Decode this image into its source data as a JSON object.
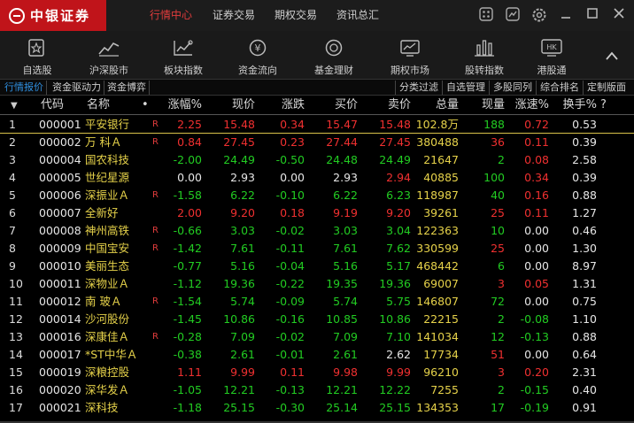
{
  "app": {
    "logo_text": "中银证券",
    "menu": [
      {
        "label": "行情中心",
        "active": true
      },
      {
        "label": "证券交易",
        "active": false
      },
      {
        "label": "期权交易",
        "active": false
      },
      {
        "label": "资讯总汇",
        "active": false
      }
    ]
  },
  "toolbar": {
    "items": [
      {
        "label": "自选股",
        "icon": "star-list-icon"
      },
      {
        "label": "沪深股市",
        "icon": "trend-chart-icon"
      },
      {
        "label": "板块指数",
        "icon": "sector-index-icon"
      },
      {
        "label": "资金流向",
        "icon": "money-flow-icon"
      },
      {
        "label": "基金理财",
        "icon": "fund-coin-icon"
      },
      {
        "label": "期权市场",
        "icon": "options-market-icon"
      },
      {
        "label": "股转指数",
        "icon": "bar-chart-icon"
      },
      {
        "label": "港股通",
        "icon": "hk-badge-icon",
        "badge": "HK"
      }
    ],
    "collapse_symbol": "^"
  },
  "tabs": {
    "left": [
      {
        "label": "行情报价",
        "active": true
      },
      {
        "label": "资金驱动力",
        "active": false
      },
      {
        "label": "资金博弈",
        "active": false
      }
    ],
    "right": [
      "分类过滤",
      "自选管理",
      "多股同列",
      "综合排名",
      "定制版面"
    ]
  },
  "table": {
    "headers": {
      "code": "代码",
      "name": "名称",
      "dot": "•",
      "change_pct": "涨幅%",
      "price": "现价",
      "change": "涨跌",
      "bid": "买价",
      "ask": "卖价",
      "volume": "总量",
      "cur_vol": "现量",
      "speed": "涨速%",
      "turnover": "换手%",
      "help": "?"
    },
    "rows": [
      {
        "idx": "1",
        "code": "000001",
        "name": "平安银行",
        "r": true,
        "pct": "2.25",
        "price": "15.48",
        "chg": "0.34",
        "bid": "15.47",
        "ask": "15.48",
        "vol": "102.8万",
        "cur": "188",
        "speed": "0.72",
        "turn": "0.53",
        "dir": "up",
        "cur_dir": "green",
        "speed_dir": "up",
        "selected": true
      },
      {
        "idx": "2",
        "code": "000002",
        "name": "万 科Ａ",
        "r": true,
        "pct": "0.84",
        "price": "27.45",
        "chg": "0.23",
        "bid": "27.44",
        "ask": "27.45",
        "vol": "380488",
        "cur": "36",
        "speed": "0.11",
        "turn": "0.39",
        "dir": "up",
        "cur_dir": "red",
        "speed_dir": "up"
      },
      {
        "idx": "3",
        "code": "000004",
        "name": "国农科技",
        "r": false,
        "pct": "-2.00",
        "price": "24.49",
        "chg": "-0.50",
        "bid": "24.48",
        "ask": "24.49",
        "vol": "21647",
        "cur": "2",
        "speed": "0.08",
        "turn": "2.58",
        "dir": "down",
        "cur_dir": "green",
        "speed_dir": "up"
      },
      {
        "idx": "4",
        "code": "000005",
        "name": "世纪星源",
        "r": false,
        "pct": "0.00",
        "price": "2.93",
        "chg": "0.00",
        "bid": "2.93",
        "ask": "2.94",
        "vol": "40885",
        "cur": "100",
        "speed": "0.34",
        "turn": "0.39",
        "dir": "flat",
        "cur_dir": "green",
        "speed_dir": "up",
        "ask_dir": "up"
      },
      {
        "idx": "5",
        "code": "000006",
        "name": "深振业Ａ",
        "r": true,
        "pct": "-1.58",
        "price": "6.22",
        "chg": "-0.10",
        "bid": "6.22",
        "ask": "6.23",
        "vol": "118987",
        "cur": "40",
        "speed": "0.16",
        "turn": "0.88",
        "dir": "down",
        "cur_dir": "green",
        "speed_dir": "up"
      },
      {
        "idx": "6",
        "code": "000007",
        "name": "全新好",
        "r": false,
        "pct": "2.00",
        "price": "9.20",
        "chg": "0.18",
        "bid": "9.19",
        "ask": "9.20",
        "vol": "39261",
        "cur": "25",
        "speed": "0.11",
        "turn": "1.27",
        "dir": "up",
        "cur_dir": "red",
        "speed_dir": "up"
      },
      {
        "idx": "7",
        "code": "000008",
        "name": "神州高铁",
        "r": true,
        "pct": "-0.66",
        "price": "3.03",
        "chg": "-0.02",
        "bid": "3.03",
        "ask": "3.04",
        "vol": "122363",
        "cur": "10",
        "speed": "0.00",
        "turn": "0.46",
        "dir": "down",
        "cur_dir": "green",
        "speed_dir": "flat"
      },
      {
        "idx": "8",
        "code": "000009",
        "name": "中国宝安",
        "r": true,
        "pct": "-1.42",
        "price": "7.61",
        "chg": "-0.11",
        "bid": "7.61",
        "ask": "7.62",
        "vol": "330599",
        "cur": "25",
        "speed": "0.00",
        "turn": "1.30",
        "dir": "down",
        "cur_dir": "red",
        "speed_dir": "flat"
      },
      {
        "idx": "9",
        "code": "000010",
        "name": "美丽生态",
        "r": false,
        "pct": "-0.77",
        "price": "5.16",
        "chg": "-0.04",
        "bid": "5.16",
        "ask": "5.17",
        "vol": "468442",
        "cur": "6",
        "speed": "0.00",
        "turn": "8.97",
        "dir": "down",
        "cur_dir": "green",
        "speed_dir": "flat"
      },
      {
        "idx": "10",
        "code": "000011",
        "name": "深物业Ａ",
        "r": false,
        "pct": "-1.12",
        "price": "19.36",
        "chg": "-0.22",
        "bid": "19.35",
        "ask": "19.36",
        "vol": "69007",
        "cur": "3",
        "speed": "0.05",
        "turn": "1.31",
        "dir": "down",
        "cur_dir": "red",
        "speed_dir": "up"
      },
      {
        "idx": "11",
        "code": "000012",
        "name": "南 玻Ａ",
        "r": true,
        "pct": "-1.54",
        "price": "5.74",
        "chg": "-0.09",
        "bid": "5.74",
        "ask": "5.75",
        "vol": "146807",
        "cur": "72",
        "speed": "0.00",
        "turn": "0.75",
        "dir": "down",
        "cur_dir": "green",
        "speed_dir": "flat"
      },
      {
        "idx": "12",
        "code": "000014",
        "name": "沙河股份",
        "r": false,
        "pct": "-1.45",
        "price": "10.86",
        "chg": "-0.16",
        "bid": "10.85",
        "ask": "10.86",
        "vol": "22215",
        "cur": "2",
        "speed": "-0.08",
        "turn": "1.10",
        "dir": "down",
        "cur_dir": "green",
        "speed_dir": "down"
      },
      {
        "idx": "13",
        "code": "000016",
        "name": "深康佳Ａ",
        "r": true,
        "pct": "-0.28",
        "price": "7.09",
        "chg": "-0.02",
        "bid": "7.09",
        "ask": "7.10",
        "vol": "141034",
        "cur": "12",
        "speed": "-0.13",
        "turn": "0.88",
        "dir": "down",
        "cur_dir": "green",
        "speed_dir": "down"
      },
      {
        "idx": "14",
        "code": "000017",
        "name": "*ST中华Ａ",
        "r": false,
        "pct": "-0.38",
        "price": "2.61",
        "chg": "-0.01",
        "bid": "2.61",
        "ask": "2.62",
        "vol": "17734",
        "cur": "51",
        "speed": "0.00",
        "turn": "0.64",
        "dir": "down",
        "cur_dir": "red",
        "speed_dir": "flat",
        "ask_dir": "flat"
      },
      {
        "idx": "15",
        "code": "000019",
        "name": "深粮控股",
        "r": false,
        "pct": "1.11",
        "price": "9.99",
        "chg": "0.11",
        "bid": "9.98",
        "ask": "9.99",
        "vol": "96210",
        "cur": "3",
        "speed": "0.20",
        "turn": "2.31",
        "dir": "up",
        "cur_dir": "red",
        "speed_dir": "up"
      },
      {
        "idx": "16",
        "code": "000020",
        "name": "深华发Ａ",
        "r": false,
        "pct": "-1.05",
        "price": "12.21",
        "chg": "-0.13",
        "bid": "12.21",
        "ask": "12.22",
        "vol": "7255",
        "cur": "2",
        "speed": "-0.15",
        "turn": "0.40",
        "dir": "down",
        "cur_dir": "green",
        "speed_dir": "down"
      },
      {
        "idx": "17",
        "code": "000021",
        "name": "深科技",
        "r": false,
        "pct": "-1.18",
        "price": "25.15",
        "chg": "-0.30",
        "bid": "25.14",
        "ask": "25.15",
        "vol": "134353",
        "cur": "17",
        "speed": "-0.19",
        "turn": "0.91",
        "dir": "down",
        "cur_dir": "green",
        "speed_dir": "down"
      }
    ]
  },
  "colors": {
    "up": "#f03030",
    "down": "#22cc22",
    "flat": "#e6e6e6",
    "name": "#e6d24a",
    "brand": "#c0141a",
    "active_tab": "#2f8fe0"
  }
}
